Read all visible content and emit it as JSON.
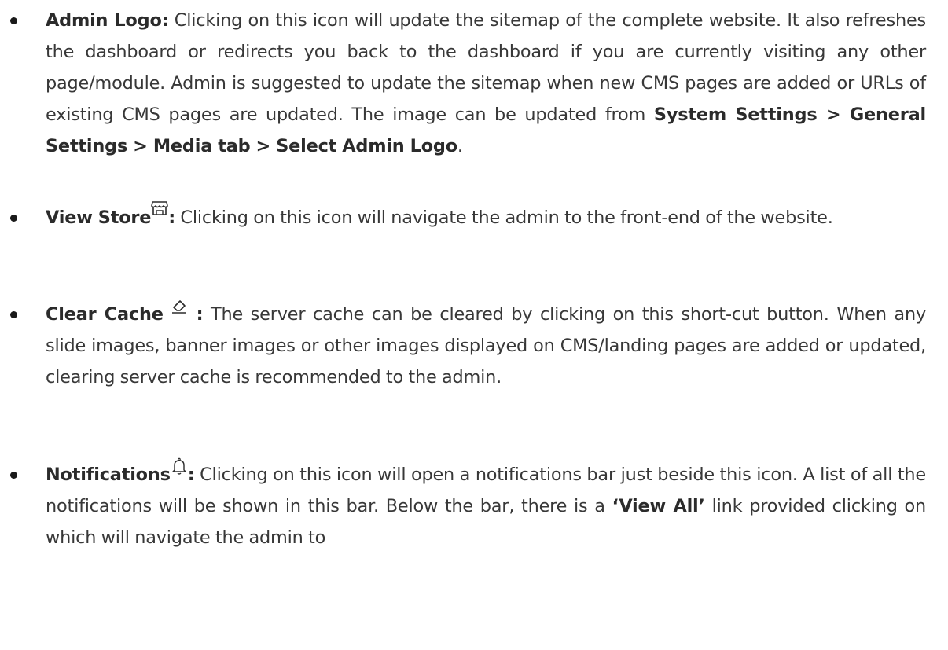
{
  "items": [
    {
      "label": "Admin Logo:",
      "text1": " Clicking on this icon will update the sitemap of the complete website. It also refreshes the dashboard or redirects you back to the dashboard if you are currently visiting any other page/module. Admin is suggested to update the sitemap when new CMS pages are added or URLs of existing CMS pages are updated. The image can be updated from ",
      "path": "System Settings > General Settings > Media tab > Select Admin Logo",
      "text2": "."
    },
    {
      "label": "View Store",
      "icon": "store-icon",
      "label_suffix": ":",
      "text1": " Clicking on this icon will navigate the admin to the front-end of the website."
    },
    {
      "label": "Clear Cache",
      "icon": "eraser-icon",
      "label_suffix": " :",
      "text1": " The server cache can be cleared by clicking on this short-cut button. When any slide images, banner images or other images displayed on CMS/landing pages are added or updated, clearing server cache is recommended to the admin."
    },
    {
      "label": "Notifications",
      "icon": "bell-icon",
      "label_suffix": ":",
      "text1": " Clicking on this icon will open a notifications bar just beside this icon. A list of all the notifications will be shown in this bar. Below the bar, there is a ",
      "link": "‘View All’",
      "text2": " link provided clicking on which will navigate the admin to"
    }
  ]
}
